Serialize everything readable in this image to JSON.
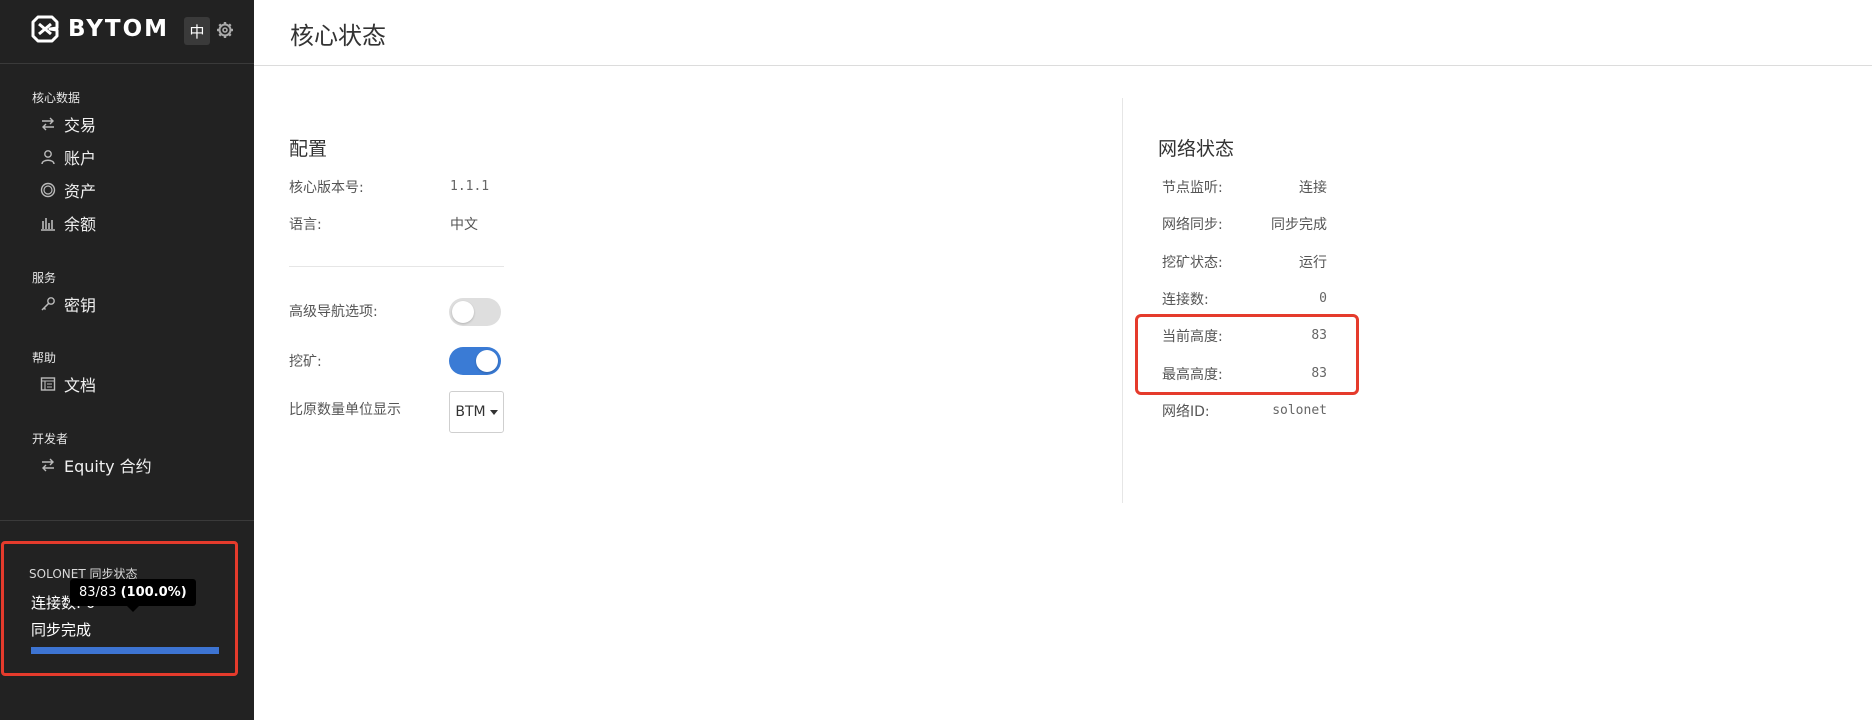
{
  "brand": {
    "name": "BYTOM",
    "lang_button": "中"
  },
  "sidebar": {
    "sections": [
      {
        "title": "核心数据",
        "items": [
          {
            "label": "交易",
            "icon": "transfer-icon"
          },
          {
            "label": "账户",
            "icon": "user-icon"
          },
          {
            "label": "资产",
            "icon": "asset-circle-icon"
          },
          {
            "label": "余额",
            "icon": "bar-chart-icon"
          }
        ]
      },
      {
        "title": "服务",
        "items": [
          {
            "label": "密钥",
            "icon": "key-icon"
          }
        ]
      },
      {
        "title": "帮助",
        "items": [
          {
            "label": "文档",
            "icon": "document-icon"
          }
        ]
      },
      {
        "title": "开发者",
        "items": [
          {
            "label": "Equity 合约",
            "icon": "transfer-icon"
          }
        ]
      }
    ],
    "sync": {
      "title": "SOLONET 同步状态",
      "connections_label": "连接数: 0",
      "status": "同步完成",
      "progress_percent": 100,
      "tooltip_count": "83/83",
      "tooltip_percent": "(100.0%)"
    }
  },
  "page": {
    "title": "核心状态"
  },
  "config": {
    "title": "配置",
    "version_label": "核心版本号:",
    "version_value": "1.1.1",
    "language_label": "语言:",
    "language_value": "中文",
    "advanced_nav_label": "高级导航选项:",
    "advanced_nav_on": false,
    "mining_label": "挖矿:",
    "mining_on": true,
    "unit_label": "比原数量单位显示",
    "unit_value": "BTM"
  },
  "network": {
    "title": "网络状态",
    "rows": [
      {
        "label": "节点监听:",
        "value": "连接"
      },
      {
        "label": "网络同步:",
        "value": "同步完成"
      },
      {
        "label": "挖矿状态:",
        "value": "运行"
      },
      {
        "label": "连接数:",
        "value": "0"
      },
      {
        "label": "当前高度:",
        "value": "83"
      },
      {
        "label": "最高高度:",
        "value": "83"
      },
      {
        "label": "网络ID:",
        "value": "solonet"
      }
    ]
  },
  "colors": {
    "sidebar_bg": "#222222",
    "accent_blue": "#3a7bd5",
    "highlight_red": "#e53b2c"
  }
}
